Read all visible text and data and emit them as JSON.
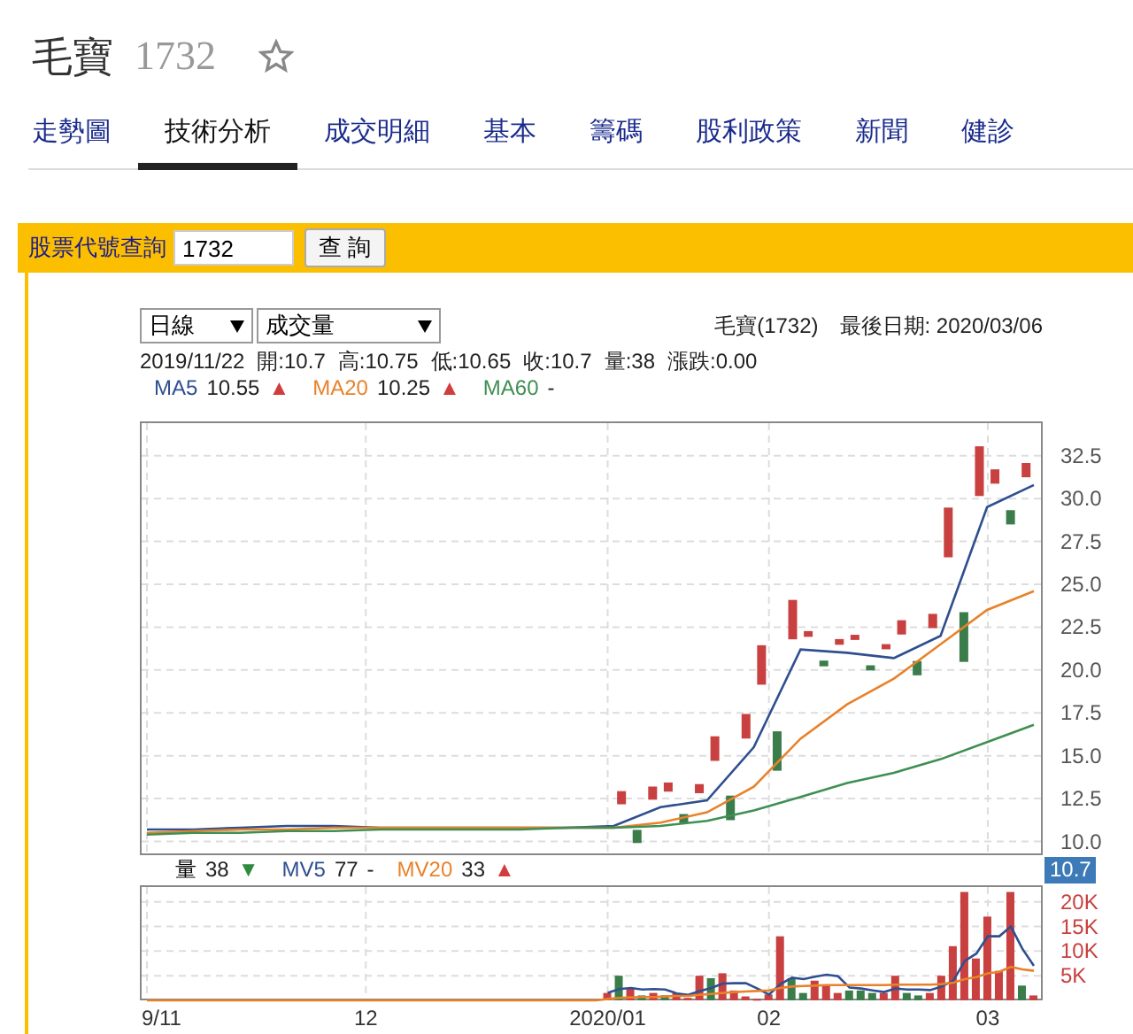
{
  "header": {
    "name": "毛寶",
    "code": "1732"
  },
  "tabs": [
    {
      "label": "走勢圖",
      "selected": false
    },
    {
      "label": "技術分析",
      "selected": true
    },
    {
      "label": "成交明細",
      "selected": false
    },
    {
      "label": "基本",
      "selected": false
    },
    {
      "label": "籌碼",
      "selected": false
    },
    {
      "label": "股利政策",
      "selected": false
    },
    {
      "label": "新聞",
      "selected": false
    },
    {
      "label": "健診",
      "selected": false
    }
  ],
  "query_bar": {
    "label": "股票代號查詢",
    "value": "1732",
    "button": "查 詢"
  },
  "selectors": [
    {
      "value": "日線"
    },
    {
      "value": "成交量"
    }
  ],
  "stock_label": "毛寶(1732)",
  "last_date": "最後日期: 2020/03/06",
  "quote": [
    "2019/11/22",
    "開:10.7",
    "高:10.75",
    "低:10.65",
    "收:10.7",
    "量:38",
    "漲跌:0.00"
  ],
  "price_legend": [
    {
      "value": "10.55",
      "arrow": "▲",
      "color": "#d23c3c"
    },
    {
      "value": "10.25",
      "arrow": "▲",
      "color": "#d23c3c"
    },
    {
      "value": "-"
    }
  ],
  "price_chart": {
    "badge": "10.7",
    "chart_data": {
      "type": "line",
      "grid": true,
      "ylim": [
        9.2,
        34.4
      ],
      "yticks": [
        {
          "value": 10,
          "label": "10.0"
        },
        {
          "value": 12.5,
          "label": "12.5"
        },
        {
          "value": 15,
          "label": "15.0"
        },
        {
          "value": 17.5,
          "label": "17.5"
        },
        {
          "value": 20,
          "label": "20.0"
        },
        {
          "value": 22.5,
          "label": "22.5"
        },
        {
          "value": 25,
          "label": "25.0"
        },
        {
          "value": 27.5,
          "label": "27.5"
        },
        {
          "value": 30,
          "label": "30.0"
        },
        {
          "value": 32.5,
          "label": "32.5"
        }
      ],
      "series": [
        {
          "name": "MA5",
          "color": "#2f4f8f",
          "values": [
            10.7,
            10.7,
            10.8,
            10.9,
            10.9,
            10.8,
            10.8,
            10.8,
            10.8,
            10.8,
            10.9,
            12.0,
            12.4,
            15.5,
            21.2,
            21.0,
            20.7,
            22.0,
            29.5,
            30.8
          ]
        },
        {
          "name": "MA20",
          "color": "#e8822a",
          "values": [
            10.5,
            10.6,
            10.7,
            10.7,
            10.8,
            10.8,
            10.8,
            10.8,
            10.8,
            10.8,
            10.8,
            11.1,
            11.7,
            13.2,
            16.0,
            18.0,
            19.5,
            21.5,
            23.5,
            24.6
          ]
        },
        {
          "name": "MA60",
          "color": "#3f8f52",
          "values": [
            10.4,
            10.5,
            10.5,
            10.6,
            10.6,
            10.7,
            10.7,
            10.7,
            10.7,
            10.8,
            10.8,
            10.9,
            11.2,
            11.8,
            12.6,
            13.4,
            14.0,
            14.8,
            15.8,
            16.8
          ]
        }
      ]
    }
  },
  "volume_legend": [
    {
      "value": "38",
      "arrow": "▼",
      "color": "#2e8b3e"
    },
    {
      "value": "77",
      "arrow": "-",
      "color": "#222222"
    },
    {
      "value": "33",
      "arrow": "▲",
      "color": "#d23c3c"
    }
  ],
  "volume_chart": {
    "chart_data": {
      "type": "bar",
      "grid": true,
      "ylim": [
        0,
        23000
      ],
      "categories": [
        "9/11",
        null,
        null,
        null,
        null,
        null,
        null,
        null,
        null,
        null,
        null,
        null,
        null,
        null,
        null,
        null,
        null,
        null,
        null,
        "12",
        null,
        null,
        null,
        null,
        null,
        null,
        null,
        null,
        null,
        null,
        null,
        null,
        null,
        null,
        null,
        null,
        null,
        null,
        null,
        null,
        "2020/01",
        null,
        null,
        null,
        null,
        null,
        null,
        null,
        null,
        null,
        null,
        null,
        null,
        null,
        "02",
        null,
        null,
        null,
        null,
        null,
        null,
        null,
        null,
        null,
        null,
        null,
        null,
        null,
        null,
        null,
        null,
        null,
        null,
        "03",
        null,
        null,
        null,
        null
      ],
      "yticks": [
        {
          "value": 5000,
          "label": "5K"
        },
        {
          "value": 10000,
          "label": "10K"
        },
        {
          "value": 15000,
          "label": "15K"
        },
        {
          "value": 20000,
          "label": "20K"
        }
      ],
      "series": [
        {
          "name": "量",
          "values": [
            null,
            null,
            null,
            null,
            null,
            null,
            null,
            null,
            null,
            null,
            null,
            null,
            null,
            null,
            null,
            null,
            null,
            null,
            null,
            null,
            null,
            null,
            null,
            null,
            null,
            null,
            null,
            null,
            null,
            null,
            null,
            null,
            null,
            null,
            null,
            null,
            null,
            null,
            null,
            null,
            1500,
            5000,
            2500,
            1000,
            1500,
            1000,
            1500,
            500,
            5000,
            4500,
            5500,
            2000,
            800,
            300,
            1200,
            13000,
            4500,
            1500,
            4000,
            3000,
            1500,
            2000,
            2000,
            1500,
            1500,
            5000,
            1500,
            1000,
            1500,
            5000,
            11000,
            22000,
            8500,
            17000,
            6000,
            22000,
            3000,
            1000
          ],
          "colors": [
            null,
            null,
            null,
            null,
            null,
            null,
            null,
            null,
            null,
            null,
            null,
            null,
            null,
            null,
            null,
            null,
            null,
            null,
            null,
            null,
            null,
            null,
            null,
            null,
            null,
            null,
            null,
            null,
            null,
            null,
            null,
            null,
            null,
            null,
            null,
            null,
            null,
            null,
            null,
            null,
            "#c8403f",
            "#3a7d4a",
            "#c8403f",
            "#3a7d4a",
            "#c8403f",
            "#3a7d4a",
            "#c8403f",
            "#c8403f",
            "#c8403f",
            "#3a7d4a",
            "#c8403f",
            "#c8403f",
            "#c8403f",
            "#c8403f",
            "#c8403f",
            "#c8403f",
            "#3a7d4a",
            "#3a7d4a",
            "#c8403f",
            "#c8403f",
            "#c8403f",
            "#3a7d4a",
            "#3a7d4a",
            "#3a7d4a",
            "#c8403f",
            "#c8403f",
            "#3a7d4a",
            "#3a7d4a",
            "#c8403f",
            "#c8403f",
            "#c8403f",
            "#c8403f",
            "#c8403f",
            "#c8403f",
            "#c8403f",
            "#c8403f",
            "#3a7d4a",
            "#c8403f"
          ]
        },
        {
          "name": "MV5",
          "type": "line",
          "color": "#2f4f8f",
          "values": [
            null,
            null,
            null,
            null,
            null,
            null,
            null,
            null,
            null,
            null,
            null,
            null,
            null,
            null,
            null,
            null,
            null,
            null,
            null,
            null,
            null,
            null,
            null,
            null,
            null,
            null,
            null,
            null,
            null,
            null,
            null,
            null,
            null,
            null,
            null,
            null,
            null,
            null,
            null,
            null,
            1500,
            2300,
            2500,
            2200,
            2300,
            2200,
            1400,
            1100,
            1900,
            2500,
            3400,
            3500,
            3500,
            2400,
            1200,
            3300,
            4600,
            4300,
            4800,
            5200,
            4900,
            2600,
            2400,
            2000,
            1700,
            2400,
            2200,
            2200,
            2100,
            2800,
            4000,
            8000,
            9500,
            13000,
            13000,
            15000,
            10500,
            7000
          ]
        },
        {
          "name": "MV20",
          "type": "line",
          "color": "#e8822a",
          "values": [
            0,
            0,
            0,
            0,
            0,
            0,
            0,
            0,
            0,
            0,
            0,
            0,
            0,
            0,
            0,
            0,
            0,
            0,
            0,
            0,
            0,
            0,
            0,
            0,
            0,
            0,
            0,
            0,
            0,
            0,
            0,
            0,
            0,
            0,
            0,
            0,
            0,
            0,
            0,
            0,
            300,
            500,
            600,
            700,
            700,
            800,
            900,
            900,
            1100,
            1300,
            1500,
            1700,
            1800,
            1900,
            2000,
            2500,
            2800,
            2900,
            3000,
            3100,
            3100,
            3100,
            3100,
            3100,
            3100,
            3200,
            3200,
            3200,
            3200,
            3300,
            3600,
            4300,
            4700,
            5500,
            5800,
            6800,
            6300,
            6000
          ]
        }
      ]
    }
  }
}
